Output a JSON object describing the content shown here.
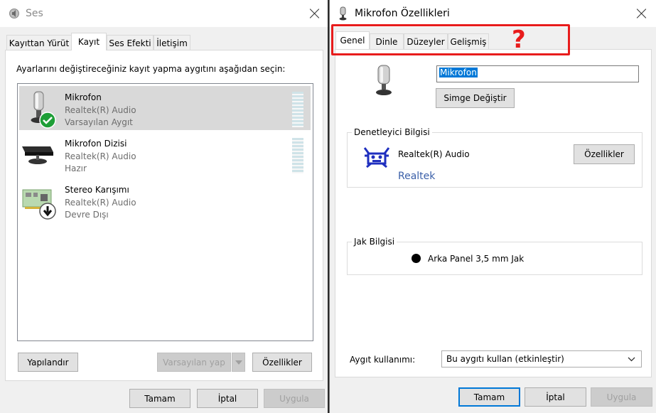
{
  "left_window": {
    "title": "Ses",
    "tabs": [
      "Kayıttan Yürüt",
      "Kayıt",
      "Ses Efekti",
      "İletişim"
    ],
    "active_tab": 1,
    "instruction": "Ayarlarını değiştireceğiniz kayıt yapma aygıtını aşağıdan seçin:",
    "devices": [
      {
        "name": "Mikrofon",
        "driver": "Realtek(R) Audio",
        "status": "Varsayılan Aygıt",
        "selected": true,
        "icon": "microphone-icon",
        "badge": "default-check-icon"
      },
      {
        "name": "Mikrofon Dizisi",
        "driver": "Realtek(R) Audio",
        "status": "Hazır",
        "selected": false,
        "icon": "microphone-array-icon"
      },
      {
        "name": "Stereo Karışımı",
        "driver": "Realtek(R) Audio",
        "status": "Devre Dışı",
        "selected": false,
        "icon": "sound-card-icon",
        "badge": "disabled-arrow-icon"
      }
    ],
    "buttons": {
      "configure": "Yapılandır",
      "set_default": "Varsayılan yap",
      "properties": "Özellikler",
      "ok": "Tamam",
      "cancel": "İptal",
      "apply": "Uygula"
    }
  },
  "right_window": {
    "title": "Mikrofon Özellikleri",
    "tabs": [
      "Genel",
      "Dinle",
      "Düzeyler",
      "Gelişmiş"
    ],
    "active_tab": 0,
    "device_name_value": "Mikrofon",
    "change_icon_button": "Simge Değiştir",
    "controller": {
      "label": "Denetleyici Bilgisi",
      "name": "Realtek(R) Audio",
      "vendor_link": "Realtek",
      "properties_button": "Özellikler"
    },
    "jack": {
      "label": "Jak Bilgisi",
      "value": "Arka Panel 3,5 mm Jak",
      "jack_color": "#000000"
    },
    "usage": {
      "label": "Aygıt kullanımı:",
      "selected": "Bu aygıtı kullan (etkinleştir)"
    },
    "buttons": {
      "ok": "Tamam",
      "cancel": "İptal",
      "apply": "Uygula"
    }
  },
  "annotation": {
    "mark": "?",
    "color": "#e81c1c"
  },
  "colors": {
    "selection": "#d9d9d9",
    "accent": "#0078d7",
    "link": "#3a5fa8",
    "realtek_blue": "#1f2fbf"
  }
}
